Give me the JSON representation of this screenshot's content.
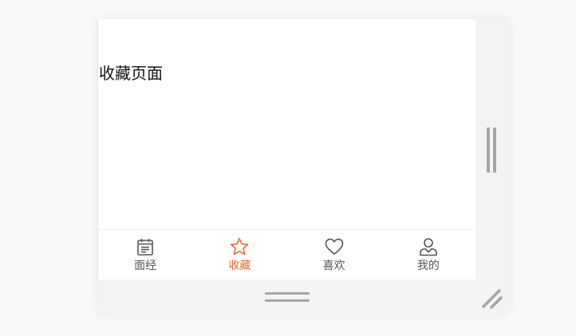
{
  "page": {
    "title": "收藏页面"
  },
  "tabbar": {
    "active_color": "#ef6c35",
    "inactive_color": "#555555",
    "items": [
      {
        "label": "面经",
        "icon": "notepad-icon",
        "active": false
      },
      {
        "label": "收藏",
        "icon": "star-icon",
        "active": true
      },
      {
        "label": "喜欢",
        "icon": "heart-icon",
        "active": false
      },
      {
        "label": "我的",
        "icon": "user-icon",
        "active": false
      }
    ]
  },
  "window": {
    "resize_handles": [
      "vertical-resize-grip-icon",
      "horizontal-resize-grip-icon",
      "corner-resize-icon"
    ]
  }
}
